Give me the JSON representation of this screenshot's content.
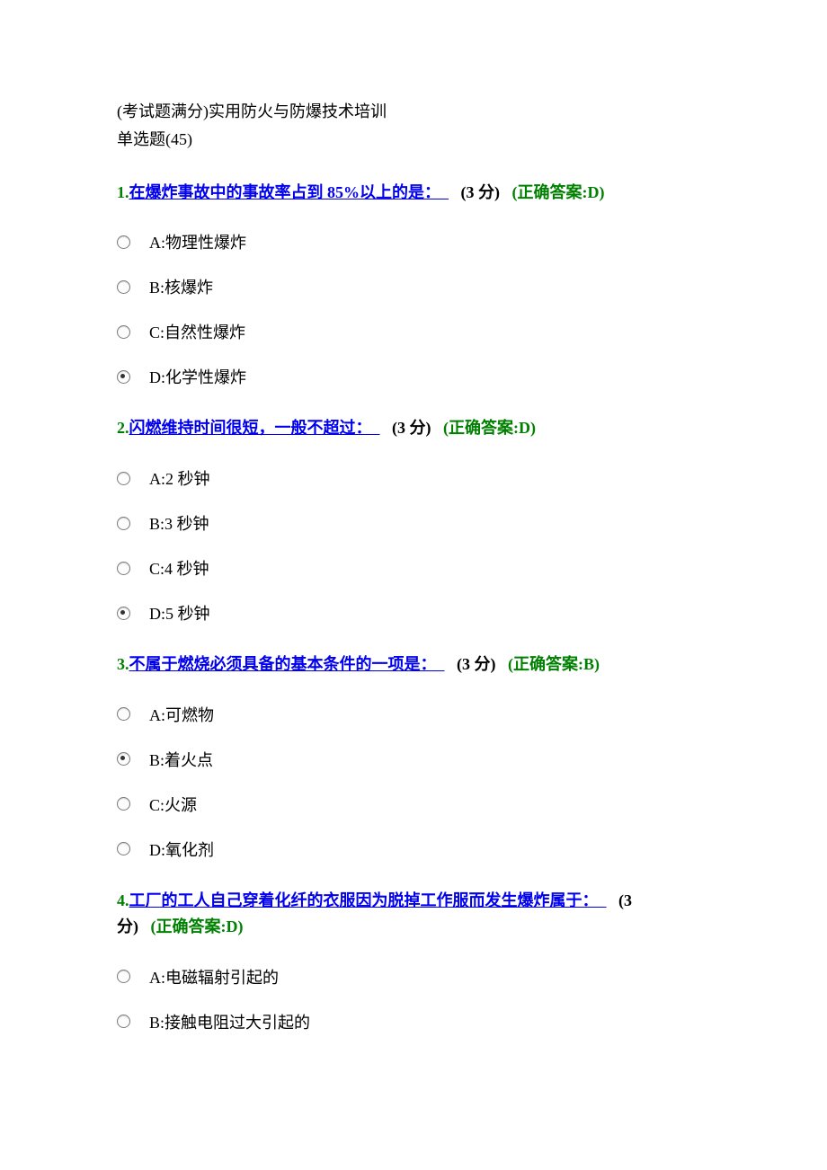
{
  "header": {
    "line1": "(考试题满分)实用防火与防爆技术培训",
    "line2": "单选题(45)"
  },
  "questions": [
    {
      "num": "1.",
      "link": "在爆炸事故中的事故率占到 85%以上的是：",
      "pad": "　",
      "points": "(3 分)",
      "correct": "(正确答案:D)",
      "selectedIndex": 3,
      "options": [
        "A:物理性爆炸",
        "B:核爆炸",
        "C:自然性爆炸",
        "D:化学性爆炸"
      ]
    },
    {
      "num": "2.",
      "link": "闪燃维持时间很短，一般不超过：",
      "pad": "　",
      "points": "(3 分)",
      "correct": "(正确答案:D)",
      "selectedIndex": 3,
      "options": [
        "A:2 秒钟",
        "B:3 秒钟",
        "C:4 秒钟",
        "D:5 秒钟"
      ]
    },
    {
      "num": "3.",
      "link": "不属于燃烧必须具备的基本条件的一项是：",
      "pad": "　",
      "points": "(3 分)",
      "correct": "(正确答案:B)",
      "selectedIndex": 1,
      "options": [
        "A:可燃物",
        "B:着火点",
        "C:火源",
        "D:氧化剂"
      ]
    },
    {
      "num": "4.",
      "link": "工厂的工人自己穿着化纤的衣服因为脱掉工作服而发生爆炸属于：",
      "pad": "　",
      "points": "(3",
      "points2": "分)",
      "correct": "(正确答案:D)",
      "selectedIndex": -1,
      "options": [
        "A:电磁辐射引起的",
        "B:接触电阻过大引起的"
      ]
    }
  ]
}
